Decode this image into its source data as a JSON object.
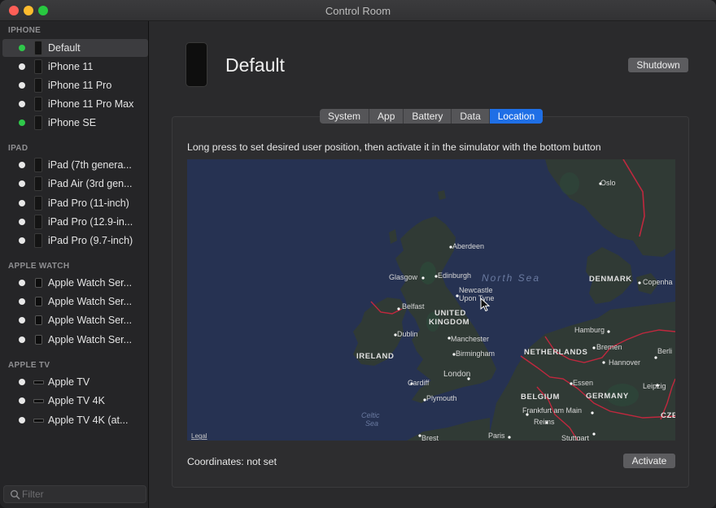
{
  "window": {
    "title": "Control Room"
  },
  "sidebar": {
    "groups": [
      {
        "header": "IPHONE",
        "devices": [
          {
            "label": "Default",
            "status": "green",
            "selected": true
          },
          {
            "label": "iPhone 11",
            "status": "white"
          },
          {
            "label": "iPhone 11 Pro",
            "status": "white"
          },
          {
            "label": "iPhone 11 Pro Max",
            "status": "white"
          },
          {
            "label": "iPhone SE",
            "status": "green"
          }
        ]
      },
      {
        "header": "IPAD",
        "devices": [
          {
            "label": "iPad (7th genera...",
            "status": "white"
          },
          {
            "label": "iPad Air (3rd gen...",
            "status": "white"
          },
          {
            "label": "iPad Pro (11-inch)",
            "status": "white"
          },
          {
            "label": "iPad Pro (12.9-in...",
            "status": "white"
          },
          {
            "label": "iPad Pro (9.7-inch)",
            "status": "white"
          }
        ]
      },
      {
        "header": "APPLE WATCH",
        "devices": [
          {
            "label": "Apple Watch Ser...",
            "status": "white"
          },
          {
            "label": "Apple Watch Ser...",
            "status": "white"
          },
          {
            "label": "Apple Watch Ser...",
            "status": "white"
          },
          {
            "label": "Apple Watch Ser...",
            "status": "white"
          }
        ]
      },
      {
        "header": "APPLE TV",
        "devices": [
          {
            "label": "Apple TV",
            "status": "white"
          },
          {
            "label": "Apple TV 4K",
            "status": "white"
          },
          {
            "label": "Apple TV 4K (at...",
            "status": "white"
          }
        ]
      }
    ],
    "filter": {
      "placeholder": "Filter",
      "icon": "search-icon"
    }
  },
  "main": {
    "device_title": "Default",
    "shutdown_label": "Shutdown",
    "tabs": [
      {
        "label": "System"
      },
      {
        "label": "App"
      },
      {
        "label": "Battery"
      },
      {
        "label": "Data"
      },
      {
        "label": "Location",
        "active": true
      }
    ],
    "location": {
      "instructions": "Long press to set desired user position, then activate it in the simulator with the bottom button",
      "coordinates_label": "Coordinates: not set",
      "activate_label": "Activate",
      "map": {
        "legal": "Legal",
        "sea_labels": [
          "North Sea",
          "Celtic",
          "Sea"
        ],
        "country_labels": [
          "UNITED",
          "KINGDOM",
          "IRELAND",
          "DENMARK",
          "NETHERLANDS",
          "BELGIUM",
          "GERMANY",
          "CZE"
        ],
        "city_labels": [
          "Oslo",
          "Aberdeen",
          "Edinburgh",
          "Glasgow",
          "Newcastle",
          "Upon Tyne",
          "Belfast",
          "Dublin",
          "Manchester",
          "Birmingham",
          "Cardiff",
          "London",
          "Plymouth",
          "Hamburg",
          "Bremen",
          "Hannover",
          "Berli",
          "Copenha",
          "Essen",
          "Leipzig",
          "Frankfurt am Main",
          "Reims",
          "Paris",
          "Stuttgart",
          "Brest"
        ]
      }
    }
  },
  "colors": {
    "accent": "#1f6fe6",
    "status_green": "#2fc84a",
    "map_sea": "#263252",
    "map_land": "#303a35",
    "border": "#c0283e"
  }
}
